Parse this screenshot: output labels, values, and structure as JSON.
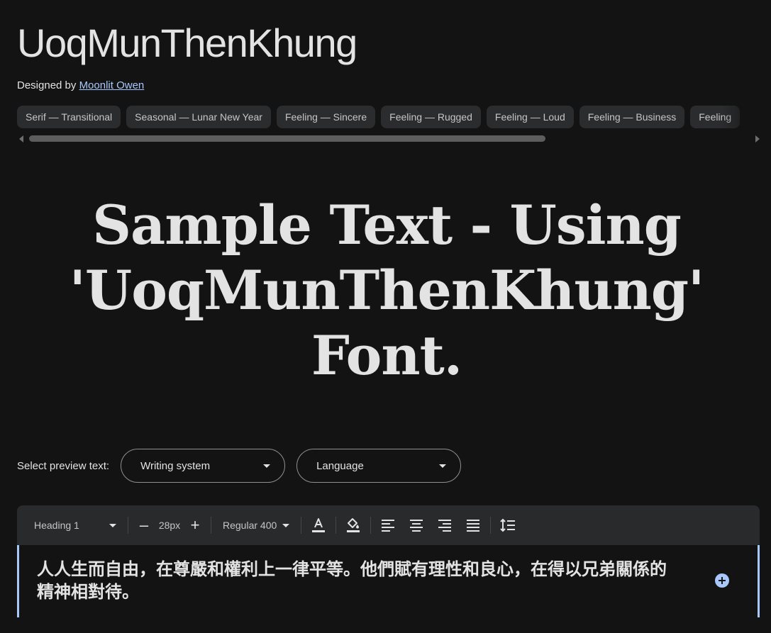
{
  "font": {
    "name": "UoqMunThenKhung",
    "designer_prefix": "Designed by",
    "designer_name": "Moonlit Owen"
  },
  "tags": [
    {
      "label": "Serif — Transitional"
    },
    {
      "label": "Seasonal — Lunar New Year"
    },
    {
      "label": "Feeling — Sincere"
    },
    {
      "label": "Feeling — Rugged"
    },
    {
      "label": "Feeling — Loud"
    },
    {
      "label": "Feeling — Business"
    },
    {
      "label": "Feeling"
    }
  ],
  "sample_text": "Sample Text - Using 'UoqMunThenKhung' Font.",
  "preview": {
    "label": "Select preview text:",
    "writing_system": "Writing system",
    "language": "Language"
  },
  "toolbar": {
    "style_value": "Heading 1",
    "size_value": "28px",
    "weight_value": "Regular 400",
    "decrease_glyph": "–",
    "increase_glyph": "+"
  },
  "editor": {
    "text": "人人生而自由，在尊嚴和權利上一律平等。他們賦有理性和良心，在得以兄弟關係的精神相對待。"
  },
  "colors": {
    "background": "#131314",
    "chip": "#2b2c2e",
    "link": "#a8c7fa",
    "toolbar": "#282a2c",
    "accent": "#a8c7fa"
  },
  "icons": {
    "text_color": "text-color-icon",
    "highlight": "fill-color-icon",
    "align_left": "align-left-icon",
    "align_center": "align-center-icon",
    "align_right": "align-right-icon",
    "align_justify": "align-justify-icon",
    "line_height": "line-height-icon",
    "add": "add-circle-icon"
  }
}
